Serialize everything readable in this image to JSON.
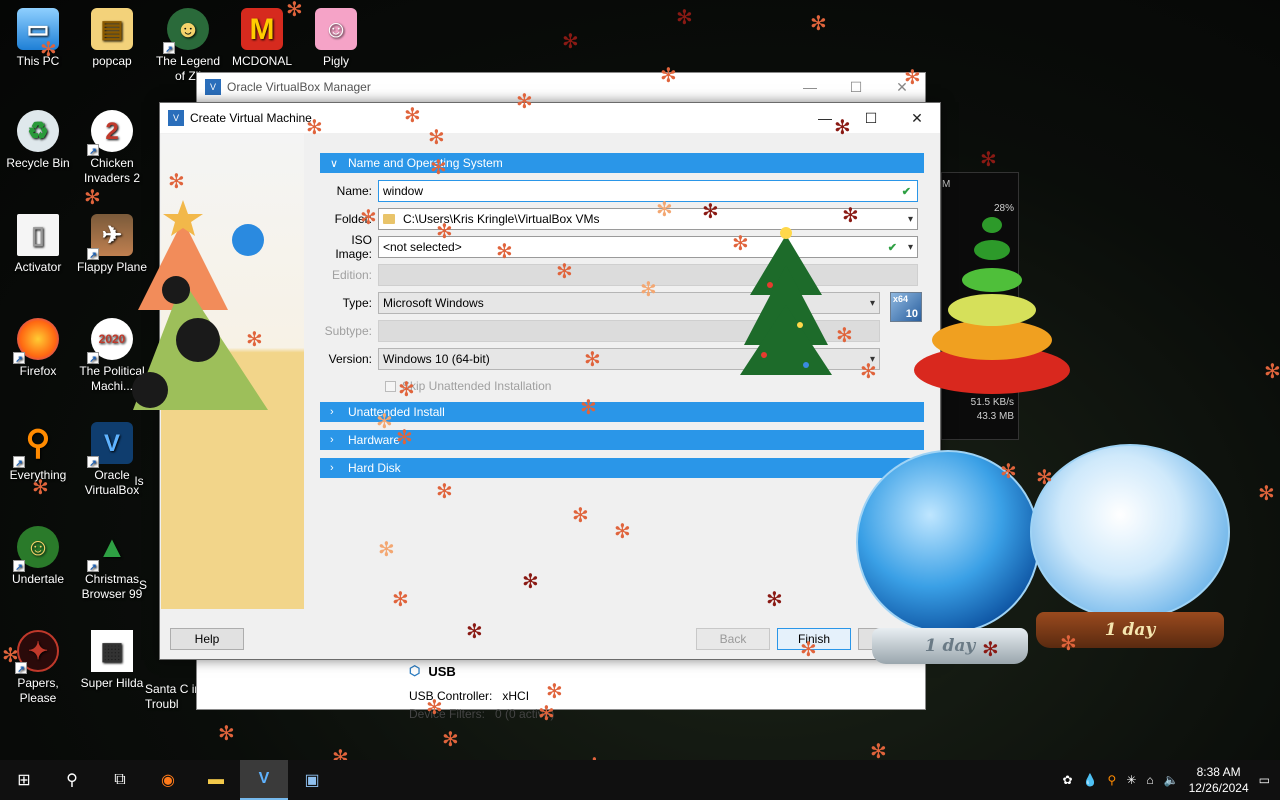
{
  "desktop": {
    "icons": [
      {
        "label": "This PC",
        "icon": "monitor-icon"
      },
      {
        "label": "popcap",
        "icon": "folder-icon"
      },
      {
        "label": "The Legend of Zil",
        "icon": "game-icon"
      },
      {
        "label": "MCDONAL",
        "icon": "mcdonalds-icon"
      },
      {
        "label": "Pigly",
        "icon": "pig-icon"
      },
      {
        "label": "Recycle Bin",
        "icon": "recycle-bin-icon"
      },
      {
        "label": "Chicken Invaders 2",
        "icon": "chicken-icon"
      },
      {
        "label": "Activator",
        "icon": "document-icon"
      },
      {
        "label": "Flappy Plane",
        "icon": "plane-icon"
      },
      {
        "label": "Firefox",
        "icon": "firefox-icon"
      },
      {
        "label": "The Political Machi...",
        "icon": "political-machine-icon"
      },
      {
        "label": "Everything",
        "icon": "search-magnifier-icon"
      },
      {
        "label": "Oracle VirtualBox",
        "icon": "virtualbox-icon"
      },
      {
        "label": "Is",
        "icon": "app-icon"
      },
      {
        "label": "Undertale",
        "icon": "undertale-icon"
      },
      {
        "label": "Christmas Browser 99",
        "icon": "christmas-tree-icon"
      },
      {
        "label": "S",
        "icon": "app-icon"
      },
      {
        "label": "Papers, Please",
        "icon": "papers-please-icon"
      },
      {
        "label": "Super Hilda",
        "icon": "pixel-character-icon"
      },
      {
        "label": "Santa C in Troubl",
        "icon": "santa-icon"
      }
    ]
  },
  "manager_window": {
    "title": "Oracle VirtualBox Manager",
    "usb": {
      "heading": "USB",
      "controller_label": "USB Controller:",
      "controller_value": "xHCI",
      "filters_text": "Device Filters:",
      "filters_value": "0 (0 active)"
    }
  },
  "dialog": {
    "title": "Create Virtual Machine",
    "sections": {
      "name_os": "Name and Operating System",
      "unattended": "Unattended Install",
      "hardware": "Hardware",
      "hard_disk": "Hard Disk"
    },
    "fields": {
      "name_label": "Name:",
      "name_value": "window",
      "folder_label": "Folder:",
      "folder_value": "C:\\Users\\Kris Kringle\\VirtualBox VMs",
      "iso_label": "ISO Image:",
      "iso_value": "<not selected>",
      "edition_label": "Edition:",
      "edition_value": "",
      "type_label": "Type:",
      "type_value": "Microsoft Windows",
      "subtype_label": "Subtype:",
      "subtype_value": "",
      "version_label": "Version:",
      "version_value": "Windows 10 (64-bit)",
      "os_badge_top": "x64",
      "os_badge_bottom": "10"
    },
    "skip_unattended_label": "Skip Unattended Installation",
    "buttons": {
      "help": "Help",
      "back": "Back",
      "finish": "Finish"
    }
  },
  "widget": {
    "label_top": "M",
    "percent": "28%",
    "net_up": "51.5 KB/s",
    "net_down": "43.3 MB"
  },
  "snow_globes": {
    "left_label": "1 day",
    "right_label": "1 day"
  },
  "taskbar": {
    "time": "8:38 AM",
    "date": "12/26/2024"
  }
}
